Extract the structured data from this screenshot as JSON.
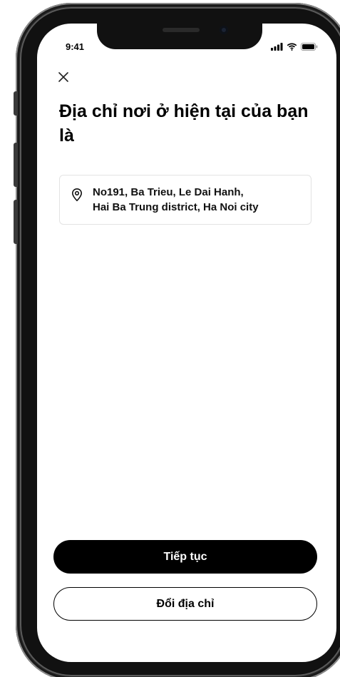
{
  "status_bar": {
    "time": "9:41",
    "icons": [
      "cellular-signal-icon",
      "wifi-icon",
      "battery-icon"
    ]
  },
  "header": {
    "close_icon": "close-icon",
    "title": "Địa chỉ nơi ở hiện tại của bạn là"
  },
  "address": {
    "icon": "location-pin-icon",
    "line1": "No191, Ba Trieu, Le Dai Hanh,",
    "line2": "Hai Ba Trung district, Ha Noi city"
  },
  "actions": {
    "continue_label": "Tiếp tục",
    "change_address_label": "Đổi địa chỉ"
  },
  "colors": {
    "primary_button": "#000000",
    "primary_button_text": "#ffffff",
    "card_border": "#e3e3e3"
  }
}
